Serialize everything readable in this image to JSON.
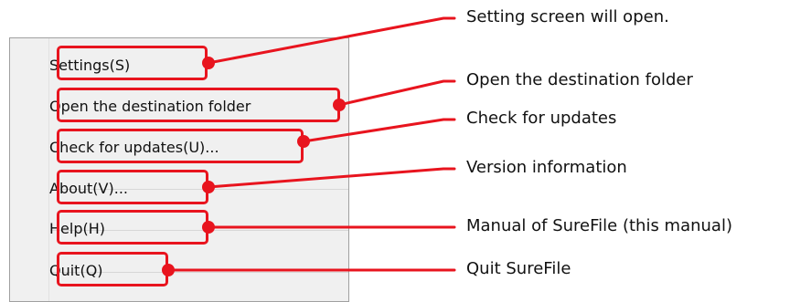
{
  "menu": {
    "items": [
      {
        "label": "Settings(S)",
        "callout": "Setting screen will open."
      },
      {
        "label": "Open the destination folder",
        "callout": "Open the destination folder"
      },
      {
        "label": "Check for updates(U)...",
        "callout": "Check for updates"
      },
      {
        "label": "About(V)...",
        "callout": "Version information"
      },
      {
        "label": "Help(H)",
        "callout": "Manual of SureFile (this manual)"
      },
      {
        "label": "Quit(Q)",
        "callout": "Quit SureFile"
      }
    ]
  },
  "colors": {
    "highlight": "#e8141e",
    "menu_bg": "#f0f0f0",
    "menu_border": "#a0a0a0"
  }
}
